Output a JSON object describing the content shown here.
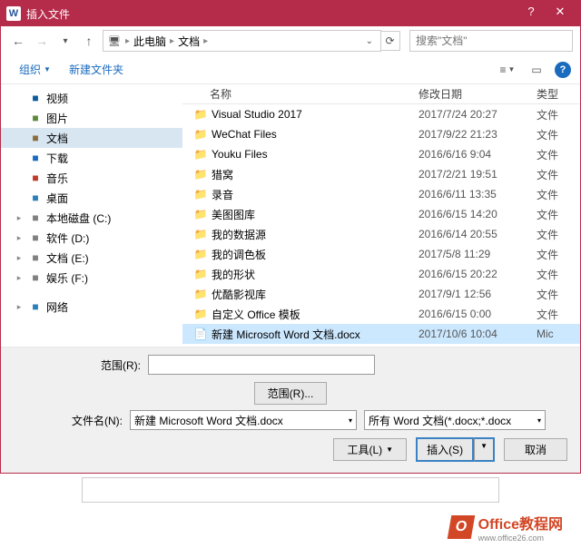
{
  "titlebar": {
    "title": "插入文件"
  },
  "nav": {
    "breadcrumb": {
      "root": "此电脑",
      "folder": "文档"
    },
    "search_placeholder": "搜索\"文档\""
  },
  "toolbar": {
    "organize": "组织",
    "newfolder": "新建文件夹",
    "view_chars": {
      "list": "≡",
      "pane": "▭"
    }
  },
  "tree": {
    "items": [
      {
        "icon": "i-video",
        "exp": "",
        "label": "视频"
      },
      {
        "icon": "i-pic",
        "exp": "",
        "label": "图片"
      },
      {
        "icon": "i-doc",
        "exp": "",
        "label": "文档",
        "sel": true
      },
      {
        "icon": "i-down",
        "exp": "",
        "label": "下载"
      },
      {
        "icon": "i-music",
        "exp": "",
        "label": "音乐"
      },
      {
        "icon": "i-desk",
        "exp": "",
        "label": "桌面"
      },
      {
        "icon": "i-disk",
        "exp": "▸",
        "label": "本地磁盘 (C:)"
      },
      {
        "icon": "i-disk",
        "exp": "▸",
        "label": "软件 (D:)"
      },
      {
        "icon": "i-disk",
        "exp": "▸",
        "label": "文档 (E:)"
      },
      {
        "icon": "i-disk",
        "exp": "▸",
        "label": "娱乐 (F:)"
      },
      {
        "icon": "i-net",
        "exp": "▸",
        "label": "网络",
        "gap": true
      }
    ]
  },
  "fileheader": {
    "name": "名称",
    "date": "修改日期",
    "type": "类型"
  },
  "files": [
    {
      "icon": "folder",
      "name": "Visual Studio 2017",
      "date": "2017/7/24 20:27",
      "type": "文件"
    },
    {
      "icon": "folder",
      "name": "WeChat Files",
      "date": "2017/9/22 21:23",
      "type": "文件"
    },
    {
      "icon": "folder",
      "name": "Youku Files",
      "date": "2016/6/16 9:04",
      "type": "文件"
    },
    {
      "icon": "folder",
      "name": "猎窝",
      "date": "2017/2/21 19:51",
      "type": "文件"
    },
    {
      "icon": "folder",
      "name": "录音",
      "date": "2016/6/11 13:35",
      "type": "文件"
    },
    {
      "icon": "folder",
      "name": "美图图库",
      "date": "2016/6/15 14:20",
      "type": "文件"
    },
    {
      "icon": "folder",
      "name": "我的数据源",
      "date": "2016/6/14 20:55",
      "type": "文件"
    },
    {
      "icon": "folder",
      "name": "我的调色板",
      "date": "2017/5/8 11:29",
      "type": "文件"
    },
    {
      "icon": "folder",
      "name": "我的形状",
      "date": "2016/6/15 20:22",
      "type": "文件"
    },
    {
      "icon": "folder",
      "name": "优酷影视库",
      "date": "2017/9/1 12:56",
      "type": "文件"
    },
    {
      "icon": "folder",
      "name": "自定义 Office 模板",
      "date": "2016/6/15 0:00",
      "type": "文件"
    },
    {
      "icon": "wordfile",
      "name": "新建 Microsoft Word 文档.docx",
      "date": "2017/10/6 10:04",
      "type": "Mic",
      "sel": true
    }
  ],
  "form": {
    "range_label": "范围(R):",
    "range_btn": "范围(R)...",
    "filename_label": "文件名(N):",
    "filename_value": "新建 Microsoft Word 文档.docx",
    "filter": "所有 Word 文档(*.docx;*.docx",
    "tools": "工具(L)",
    "insert": "插入(S)",
    "cancel": "取消"
  },
  "watermark": {
    "brand": "Office教程网",
    "url": "www.office26.com"
  }
}
